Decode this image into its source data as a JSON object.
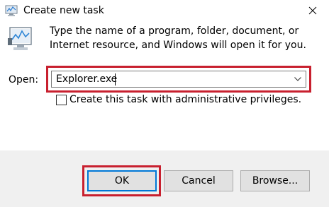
{
  "window": {
    "title": "Create new task"
  },
  "dialog": {
    "description": "Type the name of a program, folder, document, or Internet resource, and Windows will open it for you.",
    "open_label": "Open:",
    "open_value": "Explorer.exe",
    "admin_checkbox_label": "Create this task with administrative privileges.",
    "admin_checked": false
  },
  "buttons": {
    "ok": "OK",
    "cancel": "Cancel",
    "browse": "Browse..."
  },
  "icons": {
    "title": "task-manager-icon",
    "app": "task-manager-chart-icon",
    "close": "close-icon",
    "dropdown": "chevron-down-icon"
  },
  "colors": {
    "highlight": "#c8202f",
    "focus": "#0078d7"
  }
}
